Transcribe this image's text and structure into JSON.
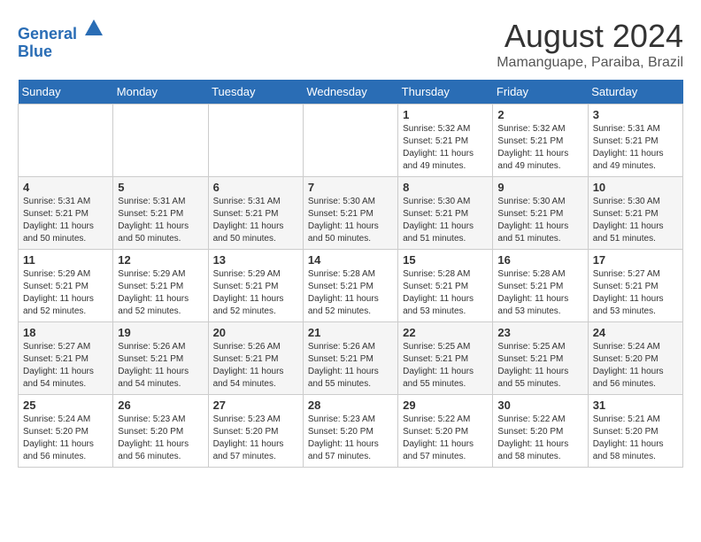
{
  "header": {
    "logo_line1": "General",
    "logo_line2": "Blue",
    "month_year": "August 2024",
    "location": "Mamanguape, Paraiba, Brazil"
  },
  "weekdays": [
    "Sunday",
    "Monday",
    "Tuesday",
    "Wednesday",
    "Thursday",
    "Friday",
    "Saturday"
  ],
  "weeks": [
    [
      {
        "day": "",
        "info": ""
      },
      {
        "day": "",
        "info": ""
      },
      {
        "day": "",
        "info": ""
      },
      {
        "day": "",
        "info": ""
      },
      {
        "day": "1",
        "info": "Sunrise: 5:32 AM\nSunset: 5:21 PM\nDaylight: 11 hours\nand 49 minutes."
      },
      {
        "day": "2",
        "info": "Sunrise: 5:32 AM\nSunset: 5:21 PM\nDaylight: 11 hours\nand 49 minutes."
      },
      {
        "day": "3",
        "info": "Sunrise: 5:31 AM\nSunset: 5:21 PM\nDaylight: 11 hours\nand 49 minutes."
      }
    ],
    [
      {
        "day": "4",
        "info": "Sunrise: 5:31 AM\nSunset: 5:21 PM\nDaylight: 11 hours\nand 50 minutes."
      },
      {
        "day": "5",
        "info": "Sunrise: 5:31 AM\nSunset: 5:21 PM\nDaylight: 11 hours\nand 50 minutes."
      },
      {
        "day": "6",
        "info": "Sunrise: 5:31 AM\nSunset: 5:21 PM\nDaylight: 11 hours\nand 50 minutes."
      },
      {
        "day": "7",
        "info": "Sunrise: 5:30 AM\nSunset: 5:21 PM\nDaylight: 11 hours\nand 50 minutes."
      },
      {
        "day": "8",
        "info": "Sunrise: 5:30 AM\nSunset: 5:21 PM\nDaylight: 11 hours\nand 51 minutes."
      },
      {
        "day": "9",
        "info": "Sunrise: 5:30 AM\nSunset: 5:21 PM\nDaylight: 11 hours\nand 51 minutes."
      },
      {
        "day": "10",
        "info": "Sunrise: 5:30 AM\nSunset: 5:21 PM\nDaylight: 11 hours\nand 51 minutes."
      }
    ],
    [
      {
        "day": "11",
        "info": "Sunrise: 5:29 AM\nSunset: 5:21 PM\nDaylight: 11 hours\nand 52 minutes."
      },
      {
        "day": "12",
        "info": "Sunrise: 5:29 AM\nSunset: 5:21 PM\nDaylight: 11 hours\nand 52 minutes."
      },
      {
        "day": "13",
        "info": "Sunrise: 5:29 AM\nSunset: 5:21 PM\nDaylight: 11 hours\nand 52 minutes."
      },
      {
        "day": "14",
        "info": "Sunrise: 5:28 AM\nSunset: 5:21 PM\nDaylight: 11 hours\nand 52 minutes."
      },
      {
        "day": "15",
        "info": "Sunrise: 5:28 AM\nSunset: 5:21 PM\nDaylight: 11 hours\nand 53 minutes."
      },
      {
        "day": "16",
        "info": "Sunrise: 5:28 AM\nSunset: 5:21 PM\nDaylight: 11 hours\nand 53 minutes."
      },
      {
        "day": "17",
        "info": "Sunrise: 5:27 AM\nSunset: 5:21 PM\nDaylight: 11 hours\nand 53 minutes."
      }
    ],
    [
      {
        "day": "18",
        "info": "Sunrise: 5:27 AM\nSunset: 5:21 PM\nDaylight: 11 hours\nand 54 minutes."
      },
      {
        "day": "19",
        "info": "Sunrise: 5:26 AM\nSunset: 5:21 PM\nDaylight: 11 hours\nand 54 minutes."
      },
      {
        "day": "20",
        "info": "Sunrise: 5:26 AM\nSunset: 5:21 PM\nDaylight: 11 hours\nand 54 minutes."
      },
      {
        "day": "21",
        "info": "Sunrise: 5:26 AM\nSunset: 5:21 PM\nDaylight: 11 hours\nand 55 minutes."
      },
      {
        "day": "22",
        "info": "Sunrise: 5:25 AM\nSunset: 5:21 PM\nDaylight: 11 hours\nand 55 minutes."
      },
      {
        "day": "23",
        "info": "Sunrise: 5:25 AM\nSunset: 5:21 PM\nDaylight: 11 hours\nand 55 minutes."
      },
      {
        "day": "24",
        "info": "Sunrise: 5:24 AM\nSunset: 5:20 PM\nDaylight: 11 hours\nand 56 minutes."
      }
    ],
    [
      {
        "day": "25",
        "info": "Sunrise: 5:24 AM\nSunset: 5:20 PM\nDaylight: 11 hours\nand 56 minutes."
      },
      {
        "day": "26",
        "info": "Sunrise: 5:23 AM\nSunset: 5:20 PM\nDaylight: 11 hours\nand 56 minutes."
      },
      {
        "day": "27",
        "info": "Sunrise: 5:23 AM\nSunset: 5:20 PM\nDaylight: 11 hours\nand 57 minutes."
      },
      {
        "day": "28",
        "info": "Sunrise: 5:23 AM\nSunset: 5:20 PM\nDaylight: 11 hours\nand 57 minutes."
      },
      {
        "day": "29",
        "info": "Sunrise: 5:22 AM\nSunset: 5:20 PM\nDaylight: 11 hours\nand 57 minutes."
      },
      {
        "day": "30",
        "info": "Sunrise: 5:22 AM\nSunset: 5:20 PM\nDaylight: 11 hours\nand 58 minutes."
      },
      {
        "day": "31",
        "info": "Sunrise: 5:21 AM\nSunset: 5:20 PM\nDaylight: 11 hours\nand 58 minutes."
      }
    ]
  ]
}
